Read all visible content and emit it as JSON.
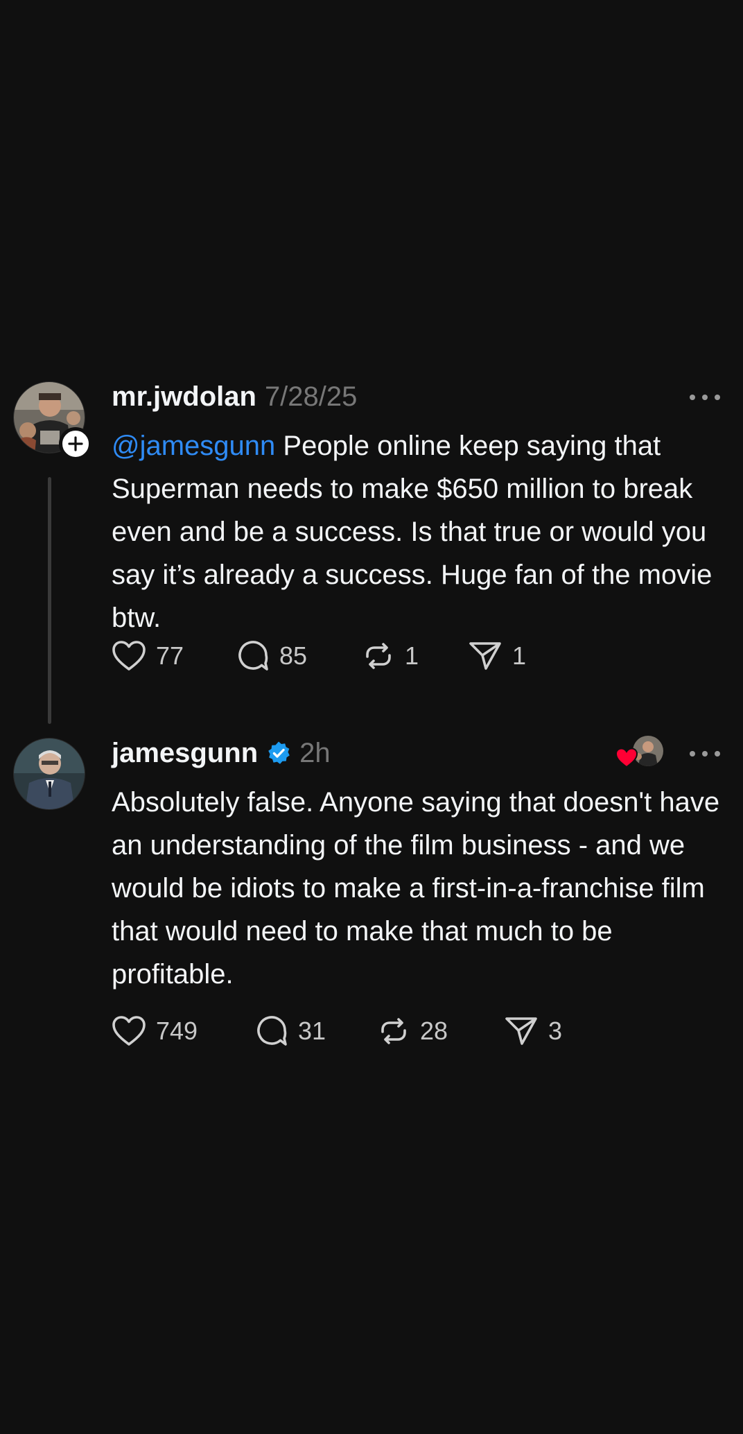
{
  "posts": [
    {
      "username": "mr.jwdolan",
      "time": "7/28/25",
      "mention": "@jamesgunn",
      "text": " People online keep saying that Superman needs to make $650 million to break even and be a success. Is that true or would you say it’s already a success. Huge fan of the movie btw.",
      "likes": "77",
      "replies": "85",
      "reposts": "1",
      "shares": "1"
    },
    {
      "username": "jamesgunn",
      "verified": true,
      "time": "2h",
      "text": "Absolutely false. Anyone saying that doesn't have an understanding of the film business - and we would be idiots to make a first-in-a-franchise film that would need to make that much to be profitable.",
      "likes": "749",
      "replies": "31",
      "reposts": "28",
      "shares": "3"
    }
  ],
  "colors": {
    "background": "#101010",
    "text": "#f3f5f7",
    "muted": "#777777",
    "mention": "#2f8bf5",
    "verified": "#1d9bf0",
    "heart": "#ff0034"
  },
  "icons": [
    "heart-icon",
    "comment-icon",
    "repost-icon",
    "share-icon",
    "more-icon",
    "verified-icon",
    "plus-icon"
  ]
}
